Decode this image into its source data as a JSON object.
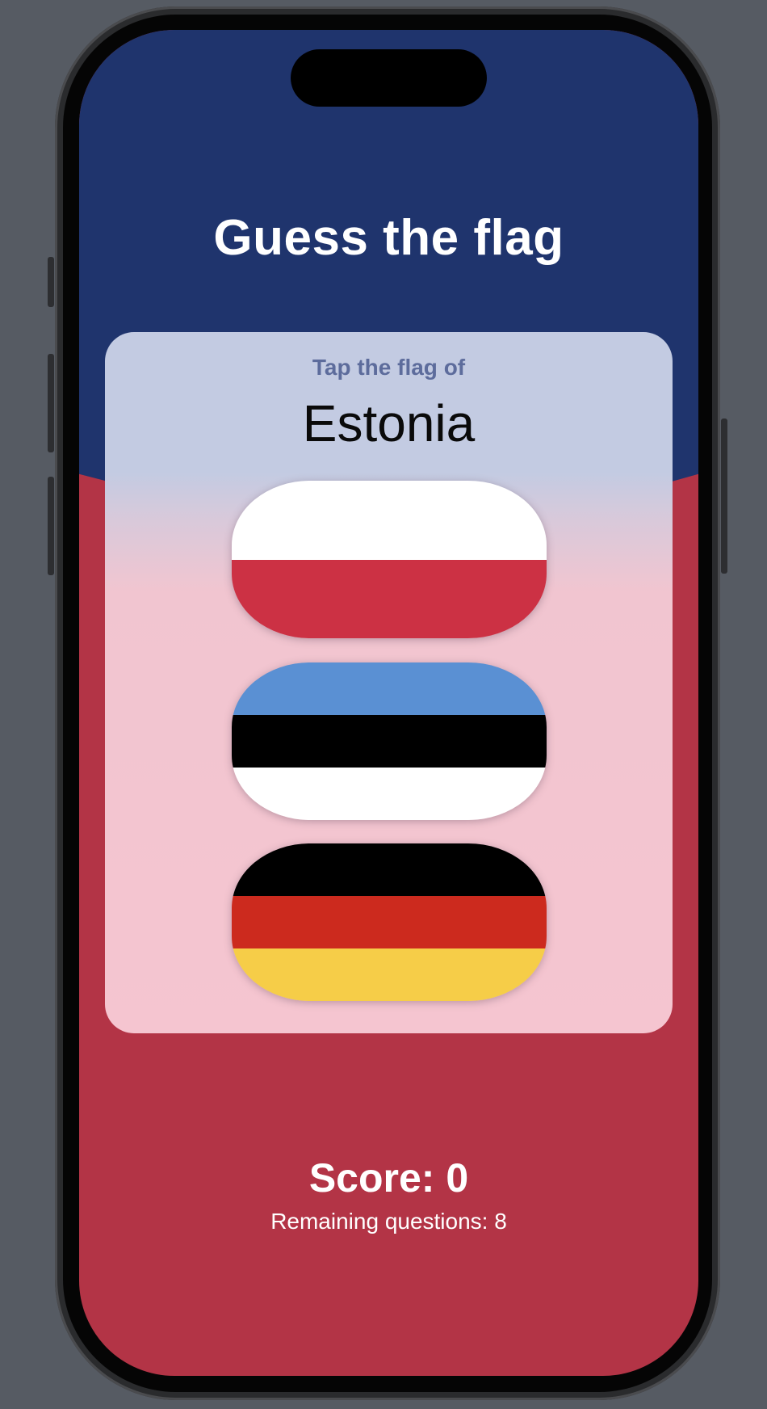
{
  "app": {
    "title": "Guess the flag"
  },
  "question": {
    "prompt": "Tap the flag of",
    "country": "Estonia"
  },
  "flags": [
    {
      "name": "Poland",
      "stripes": [
        "#ffffff",
        "#cc3144"
      ]
    },
    {
      "name": "Estonia",
      "stripes": [
        "#5a90d3",
        "#000000",
        "#ffffff"
      ]
    },
    {
      "name": "Germany",
      "stripes": [
        "#000000",
        "#cc2a1e",
        "#f6cd48"
      ]
    }
  ],
  "status": {
    "score": "Score: 0",
    "remaining": "Remaining questions: 8"
  },
  "colors": {
    "background_top": "#1f346d",
    "background_bottom": "#b33446",
    "prompt": "#5d6c9c",
    "card_top": "#c3cbe2",
    "card_bottom": "#f5c5d0"
  }
}
